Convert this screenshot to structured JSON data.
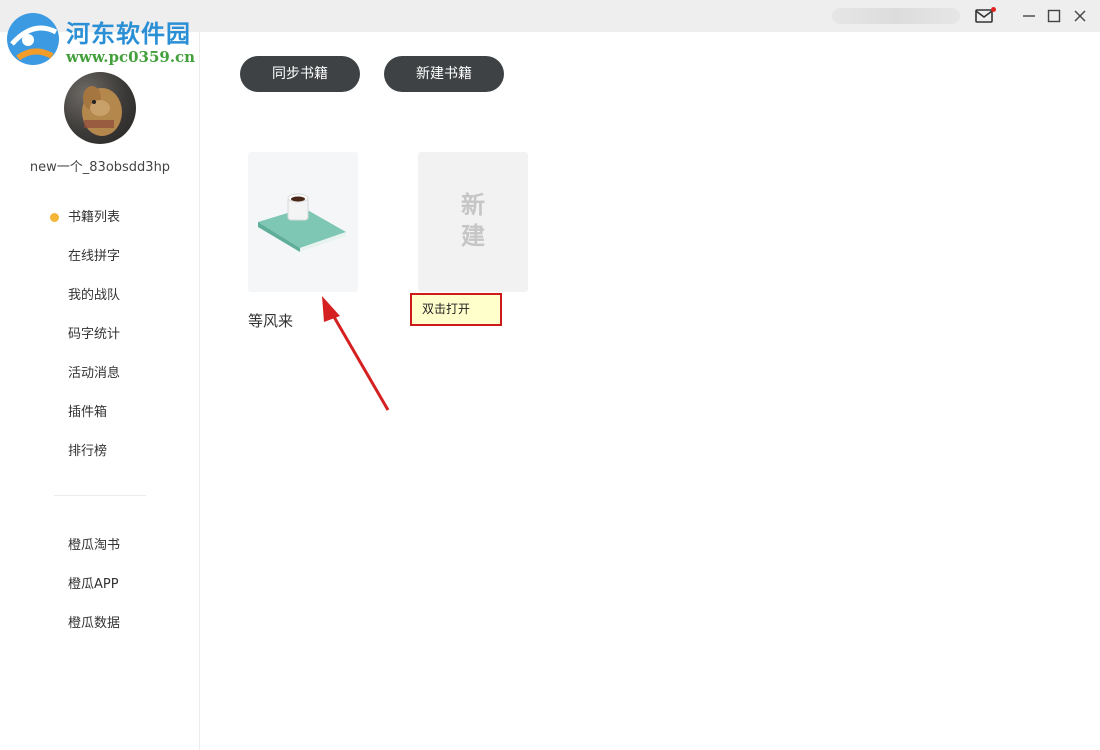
{
  "watermark": {
    "title": "河东软件园",
    "url": "www.pc0359.cn"
  },
  "user": {
    "name": "new一个_83obsdd3hp"
  },
  "sidebar": {
    "primary": [
      {
        "label": "书籍列表",
        "active": true
      },
      {
        "label": "在线拼字"
      },
      {
        "label": "我的战队"
      },
      {
        "label": "码字统计"
      },
      {
        "label": "活动消息"
      },
      {
        "label": "插件箱"
      },
      {
        "label": "排行榜"
      }
    ],
    "secondary": [
      {
        "label": "橙瓜淘书"
      },
      {
        "label": "橙瓜APP"
      },
      {
        "label": "橙瓜数据"
      }
    ]
  },
  "toolbar": {
    "sync_label": "同步书籍",
    "new_label": "新建书籍"
  },
  "books": [
    {
      "title": "等风来"
    }
  ],
  "new_book": {
    "line1": "新",
    "line2": "建"
  },
  "tooltip": {
    "text": "双击打开"
  },
  "colors": {
    "accent_dot": "#f5b638",
    "button_bg": "#3f4244",
    "annotation_red": "#cc1a1a",
    "notification_dot": "#e02424"
  },
  "icons": {
    "mail": "mail-icon",
    "minimize": "minimize-icon",
    "maximize": "maximize-icon",
    "close": "close-icon"
  }
}
